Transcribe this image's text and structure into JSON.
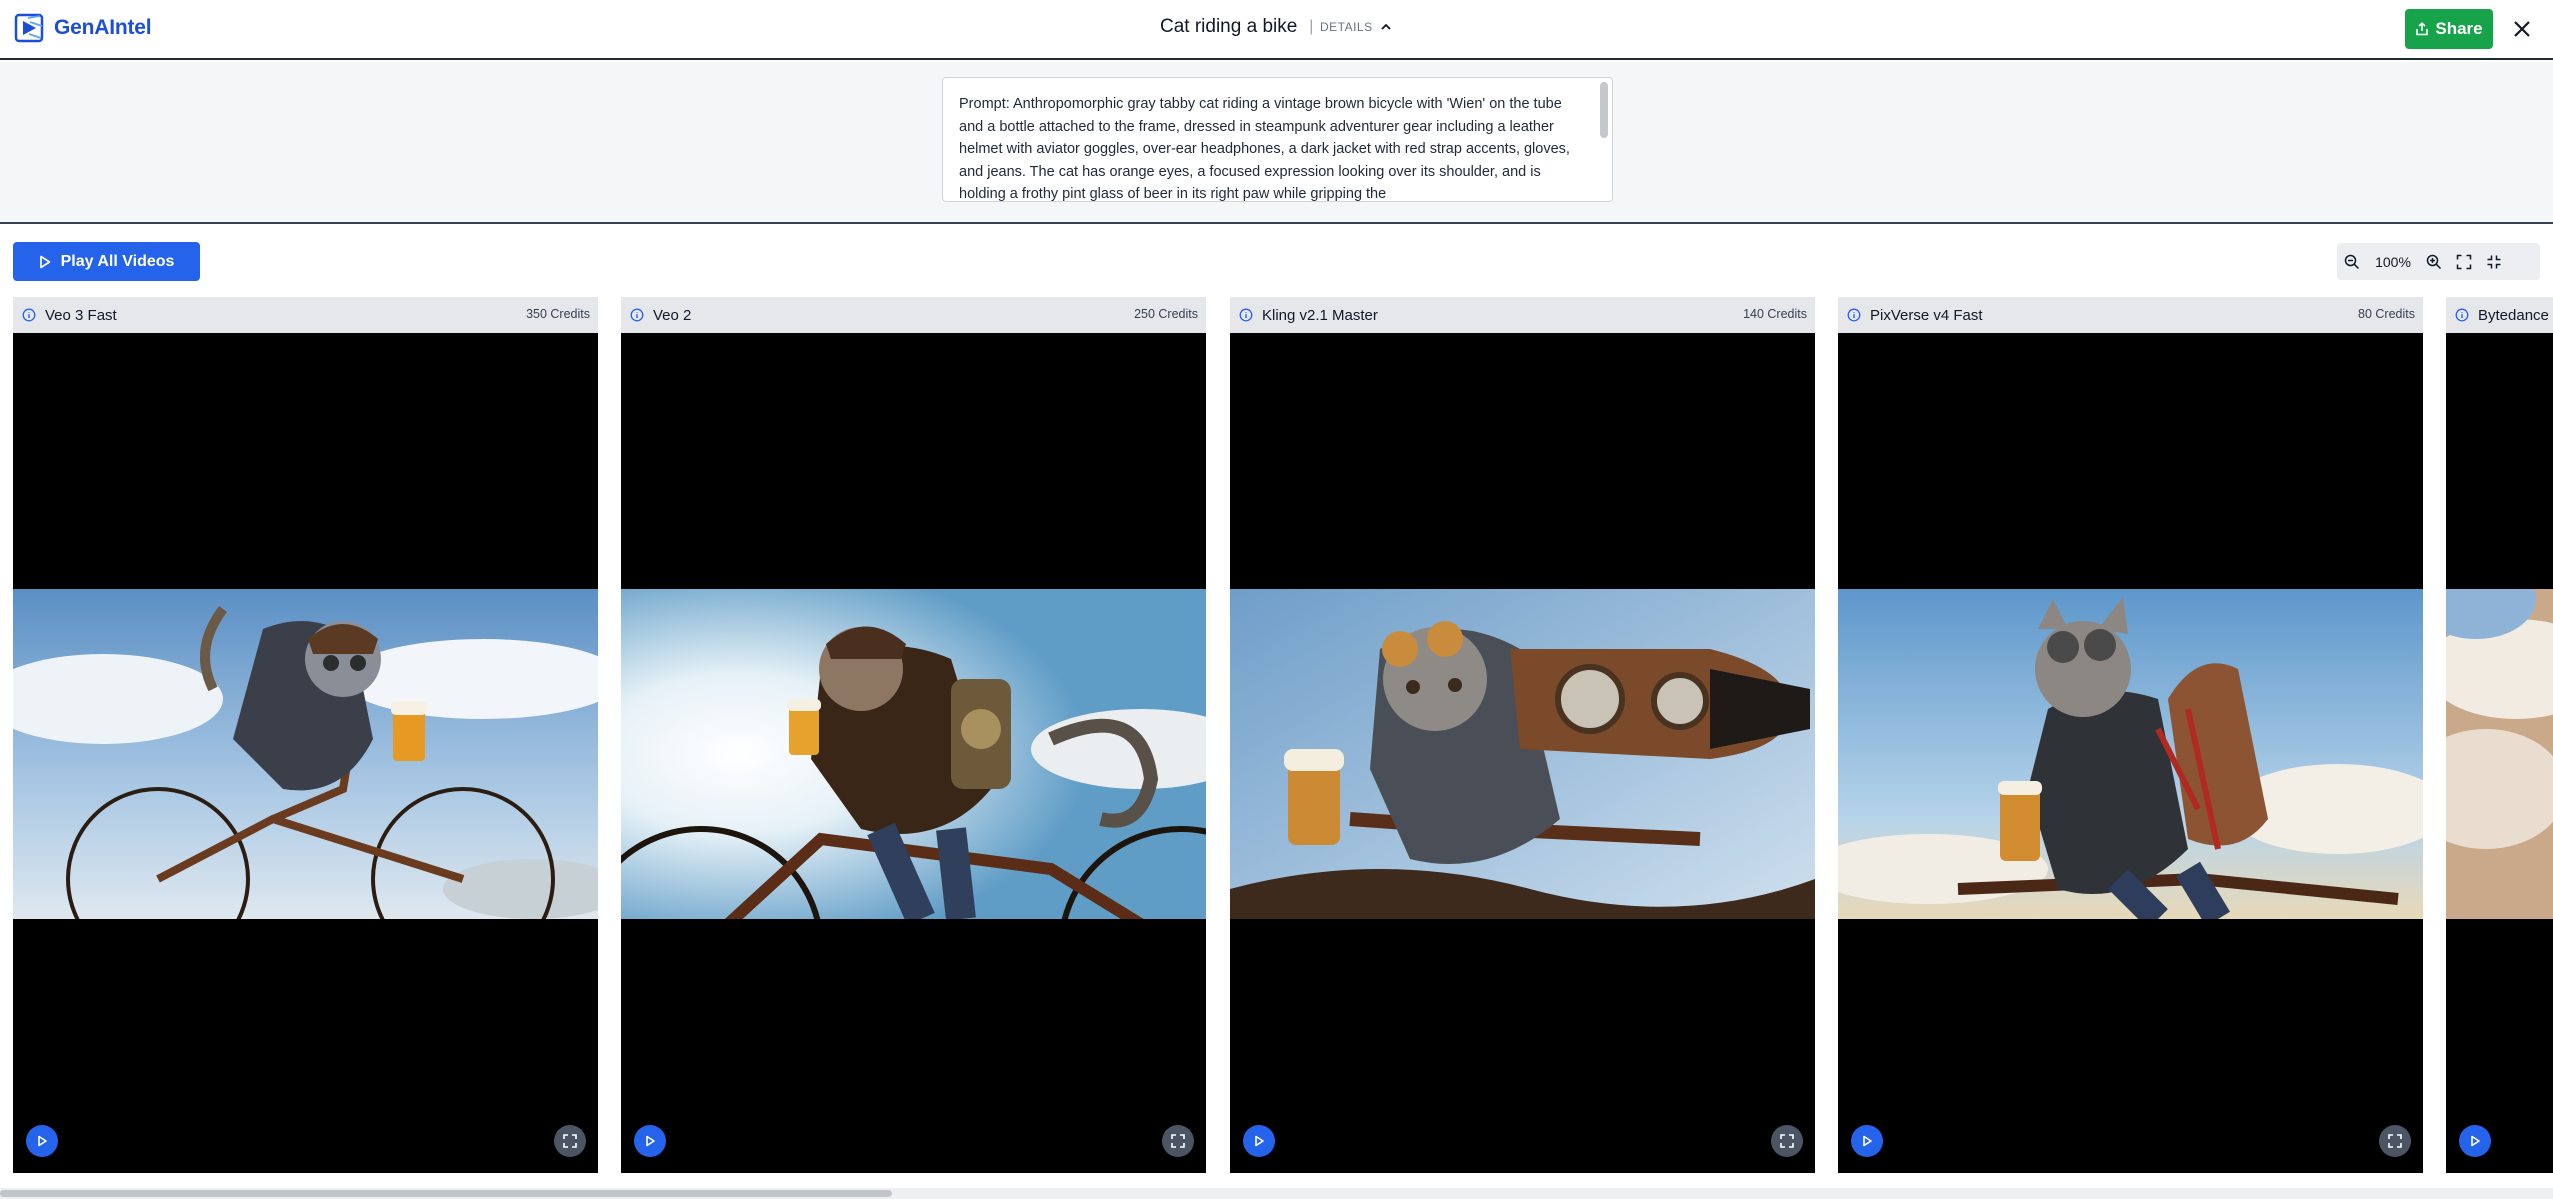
{
  "app": {
    "brand": "GenAIntel"
  },
  "header": {
    "title": "Cat riding a bike",
    "details_label": "DETAILS",
    "share_label": "Share"
  },
  "prompt": {
    "text": "Prompt: Anthropomorphic gray tabby cat riding a vintage brown bicycle with 'Wien' on the tube and a bottle attached to the frame, dressed in steampunk adventurer gear including a leather helmet with aviator goggles, over-ear headphones, a dark jacket with red strap accents, gloves, and jeans. The cat has orange eyes, a focused expression looking over its shoulder, and is holding a frothy pint glass of beer in its right paw while gripping the"
  },
  "toolbar": {
    "play_all_label": "Play All Videos",
    "zoom_level": "100%"
  },
  "cards": [
    {
      "name": "Veo 3 Fast",
      "credits": "350 Credits"
    },
    {
      "name": "Veo 2",
      "credits": "250 Credits"
    },
    {
      "name": "Kling v2.1 Master",
      "credits": "140 Credits"
    },
    {
      "name": "PixVerse v4 Fast",
      "credits": "80 Credits"
    },
    {
      "name": "Bytedance",
      "credits": ""
    }
  ],
  "colors": {
    "brand": "#1d4ed8",
    "share": "#16a34a",
    "primary": "#2563eb"
  }
}
